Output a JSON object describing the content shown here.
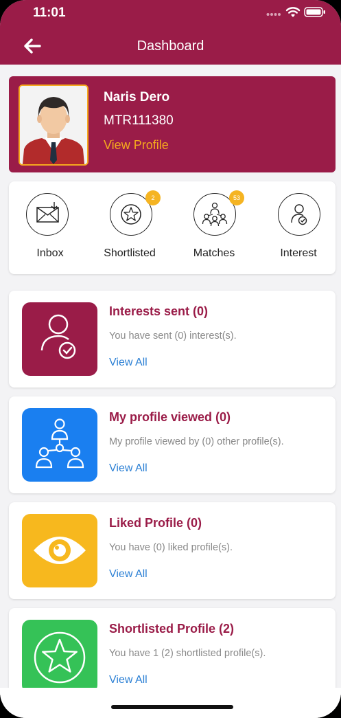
{
  "status_bar": {
    "time": "11:01"
  },
  "header": {
    "title": "Dashboard"
  },
  "profile": {
    "name": "Naris Dero",
    "id": "MTR111380",
    "link": "View Profile"
  },
  "quick_links": [
    {
      "label": "Inbox",
      "icon": "envelope-icon",
      "badge": ""
    },
    {
      "label": "Shortlisted",
      "icon": "star-icon",
      "badge": "2"
    },
    {
      "label": "Matches",
      "icon": "people-network-icon",
      "badge": "53"
    },
    {
      "label": "Interest",
      "icon": "user-check-icon",
      "badge": ""
    }
  ],
  "cards": [
    {
      "title": "Interests sent (0)",
      "desc": "You have sent (0) interest(s).",
      "link": "View All",
      "icon": "user-check-icon",
      "color": "#9a1c48"
    },
    {
      "title": "My profile viewed (0)",
      "desc": "My profile viewed by (0) other profile(s).",
      "link": "View All",
      "icon": "people-network-icon",
      "color": "#1a7ff0"
    },
    {
      "title": "Liked Profile (0)",
      "desc": "You have (0) liked profile(s).",
      "link": "View All",
      "icon": "eye-icon",
      "color": "#f7b81e"
    },
    {
      "title": "Shortlisted Profile (2)",
      "desc": "You have 1 (2) shortlisted profile(s).",
      "link": "View All",
      "icon": "star-icon",
      "color": "#35c257"
    }
  ],
  "colors": {
    "primary": "#9a1c48",
    "accent": "#f5a91e",
    "link": "#2a7fd4"
  }
}
